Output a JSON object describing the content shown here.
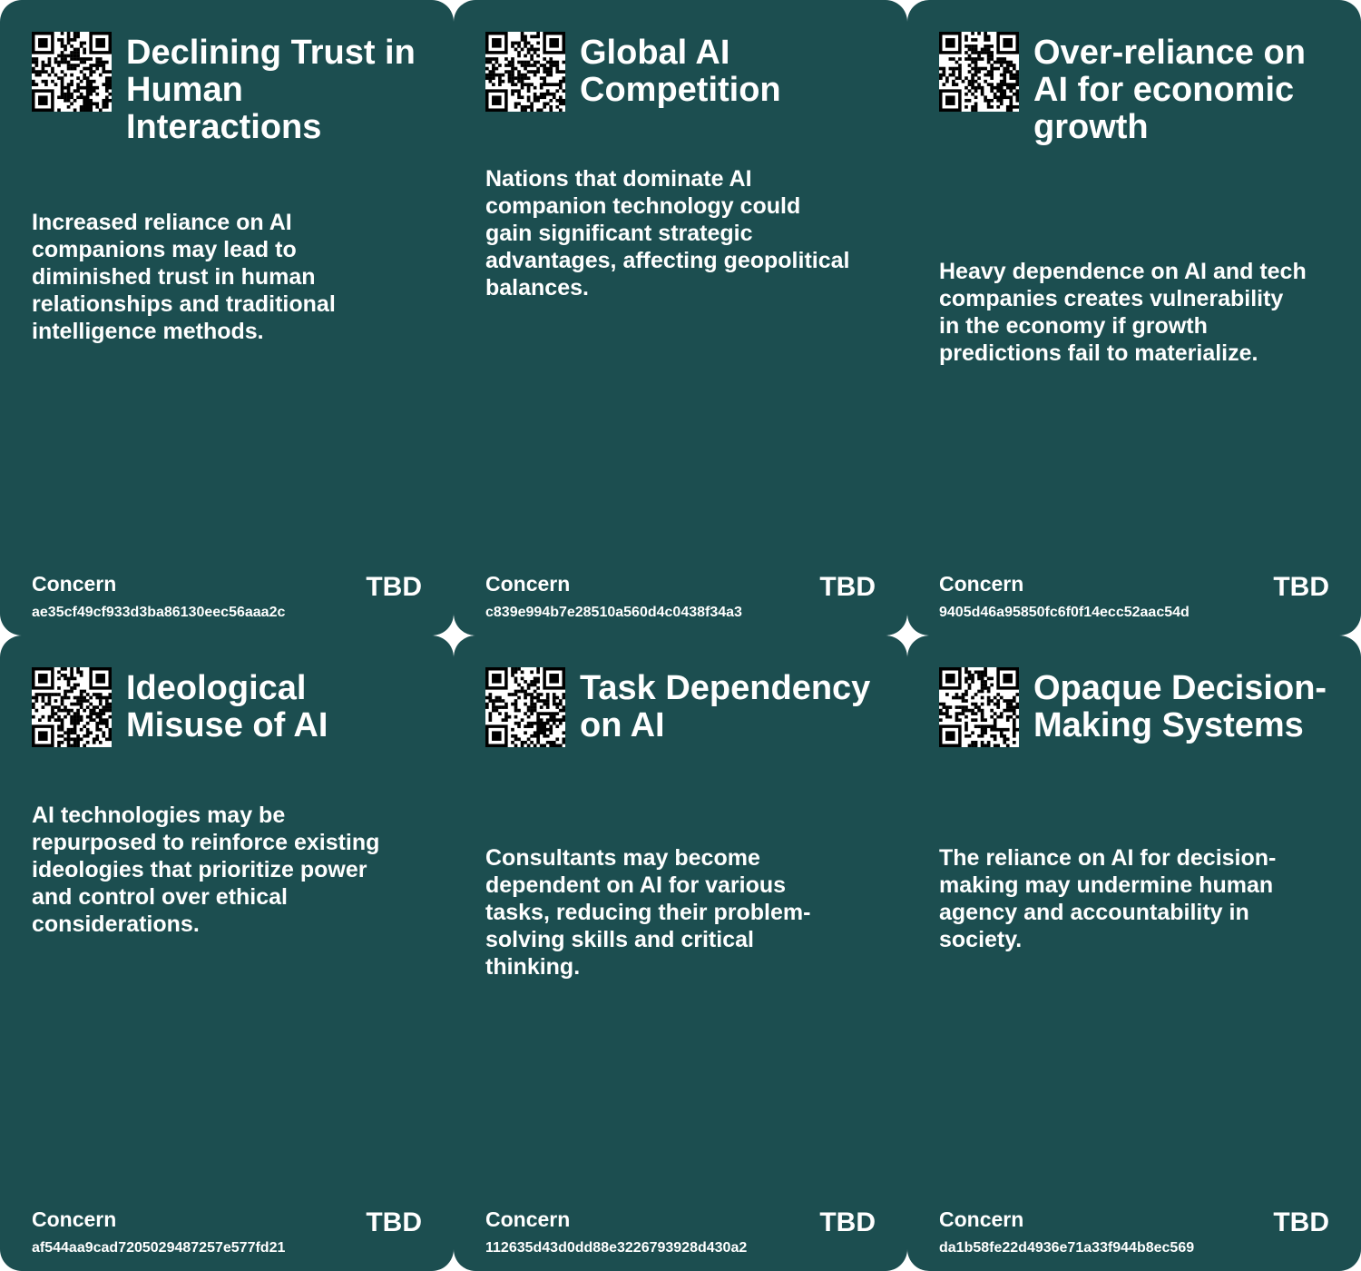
{
  "colors": {
    "card_bg": "#1c4e50",
    "text": "#ffffff",
    "gap": "#ffffff"
  },
  "cards": [
    {
      "title": "Declining Trust in Human Interactions",
      "description": "Increased reliance on AI companions may lead to diminished trust in human relationships and traditional intelligence methods.",
      "type": "Concern",
      "status": "TBD",
      "hash": "ae35cf49cf933d3ba86130eec56aaa2c"
    },
    {
      "title": "Global AI Competition",
      "description": "Nations that dominate AI companion technology could gain significant strategic advantages, affecting geopolitical balances.",
      "type": "Concern",
      "status": "TBD",
      "hash": "c839e994b7e28510a560d4c0438f34a3"
    },
    {
      "title": "Over-reliance on AI for economic growth",
      "description": "Heavy dependence on AI and tech companies creates vulnerability in the economy if growth predictions fail to materialize.",
      "type": "Concern",
      "status": "TBD",
      "hash": "9405d46a95850fc6f0f14ecc52aac54d"
    },
    {
      "title": "Ideological Misuse of AI",
      "description": "AI technologies may be repurposed to reinforce existing ideologies that prioritize power and control over ethical considerations.",
      "type": "Concern",
      "status": "TBD",
      "hash": "af544aa9cad7205029487257e577fd21"
    },
    {
      "title": "Task Dependency on AI",
      "description": "Consultants may become dependent on AI for various tasks, reducing their problem-solving skills and critical thinking.",
      "type": "Concern",
      "status": "TBD",
      "hash": "112635d43d0dd88e3226793928d430a2"
    },
    {
      "title": "Opaque Decision-Making Systems",
      "description": "The reliance on AI for decision-making may undermine human agency and accountability in society.",
      "type": "Concern",
      "status": "TBD",
      "hash": "da1b58fe22d4936e71a33f944b8ec569"
    }
  ]
}
